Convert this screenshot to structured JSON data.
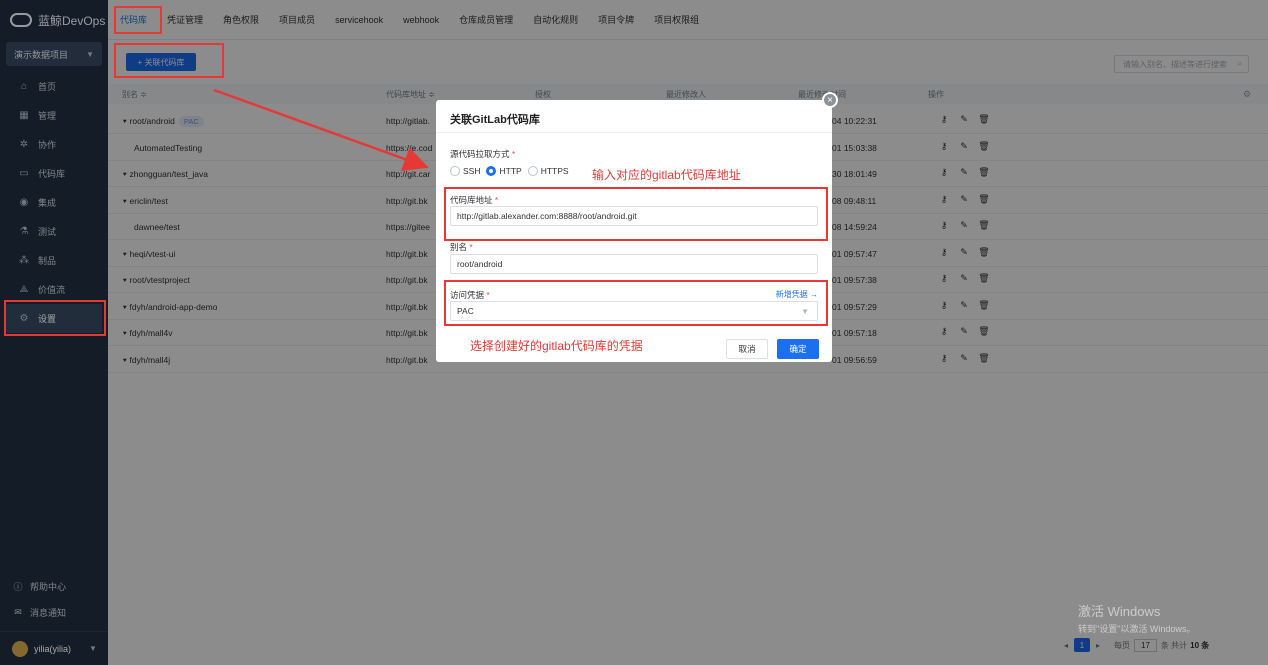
{
  "app": {
    "logo_text": "蓝鲸DevOps"
  },
  "project_select": {
    "value": "演示数据项目"
  },
  "nav": {
    "items": [
      {
        "label": "首页",
        "icon": "home-icon",
        "glyph": "⌂"
      },
      {
        "label": "管理",
        "icon": "grid-icon",
        "glyph": "▦"
      },
      {
        "label": "协作",
        "icon": "collab-icon",
        "glyph": "✲"
      },
      {
        "label": "代码库",
        "icon": "code-icon",
        "glyph": "▭"
      },
      {
        "label": "集成",
        "icon": "integration-icon",
        "glyph": "◉"
      },
      {
        "label": "测试",
        "icon": "test-icon",
        "glyph": "⚗"
      },
      {
        "label": "制品",
        "icon": "artifact-icon",
        "glyph": "⁂"
      },
      {
        "label": "价值流",
        "icon": "valuestream-icon",
        "glyph": "⟁"
      },
      {
        "label": "设置",
        "icon": "settings-icon",
        "glyph": "⚙"
      }
    ],
    "help": "帮助中心",
    "notify": "消息通知",
    "user": "yilia(yilia)"
  },
  "tabs": [
    "代码库",
    "凭证管理",
    "角色权限",
    "项目成员",
    "servicehook",
    "webhook",
    "仓库成员管理",
    "自动化规则",
    "项目令牌",
    "项目权限组"
  ],
  "toolbar": {
    "add_label": "+ 关联代码库",
    "search_placeholder": "请输入别名、描述等进行搜索"
  },
  "table": {
    "headers": [
      "别名 ≑",
      "代码库地址 ≑",
      "授权",
      "最近修改人",
      "最近修改时间",
      "操作"
    ],
    "rows": [
      {
        "name": "root/android",
        "tag": "PAC",
        "url": "http://gitlab.",
        "time": "04 10:22:31",
        "git_icon": true
      },
      {
        "name": "AutomatedTesting",
        "url": "https://e.cod",
        "time": "01 15:03:38",
        "git_icon": false
      },
      {
        "name": "zhongguan/test_java",
        "url": "http://git.car",
        "time": "30 18:01:49",
        "git_icon": true
      },
      {
        "name": "ericlin/test",
        "url": "http://git.bk",
        "time": "08 09:48:11",
        "git_icon": true
      },
      {
        "name": "dawnee/test",
        "url": "https://gitee",
        "time": "08 14:59:24",
        "git_icon": false
      },
      {
        "name": "heqi/vtest-ui",
        "url": "http://git.bk",
        "time": "01 09:57:47",
        "git_icon": true
      },
      {
        "name": "root/vtestproject",
        "url": "http://git.bk",
        "time": "01 09:57:38",
        "git_icon": true
      },
      {
        "name": "fdyh/android-app-demo",
        "url": "http://git.bk",
        "time": "01 09:57:29",
        "git_icon": true
      },
      {
        "name": "fdyh/mall4v",
        "url": "http://git.bk",
        "time": "01 09:57:18",
        "git_icon": true
      },
      {
        "name": "fdyh/mall4j",
        "url": "http://git.bk",
        "time": "01 09:56:59",
        "git_icon": true
      }
    ]
  },
  "dialog": {
    "title": "关联GitLab代码库",
    "pull_method_label": "源代码拉取方式",
    "options": [
      "SSH",
      "HTTP",
      "HTTPS"
    ],
    "selected_option": "HTTP",
    "url_label": "代码库地址",
    "url_value": "http://gitlab.alexander.com:8888/root/android.git",
    "alias_label": "别名",
    "alias_value": "root/android",
    "credential_label": "访问凭据",
    "credential_link": "新增凭据 →",
    "credential_value": "PAC",
    "cancel_label": "取消",
    "ok_label": "确定"
  },
  "annotations": {
    "url_hint": "输入对应的gitlab代码库地址",
    "credential_hint": "选择创建好的gitlab代码库的凭据"
  },
  "watermark": {
    "line1": "激活 Windows",
    "line2": "转到\"设置\"以激活 Windows。"
  },
  "pagination": {
    "current": "1",
    "per_page_label": "每页",
    "per_page": "17",
    "total_label": "条  共计",
    "total": "10 条"
  },
  "colors": {
    "sidebar_bg": "#1f2d3d",
    "primary": "#1d6ff2",
    "annotation": "#e53935"
  }
}
